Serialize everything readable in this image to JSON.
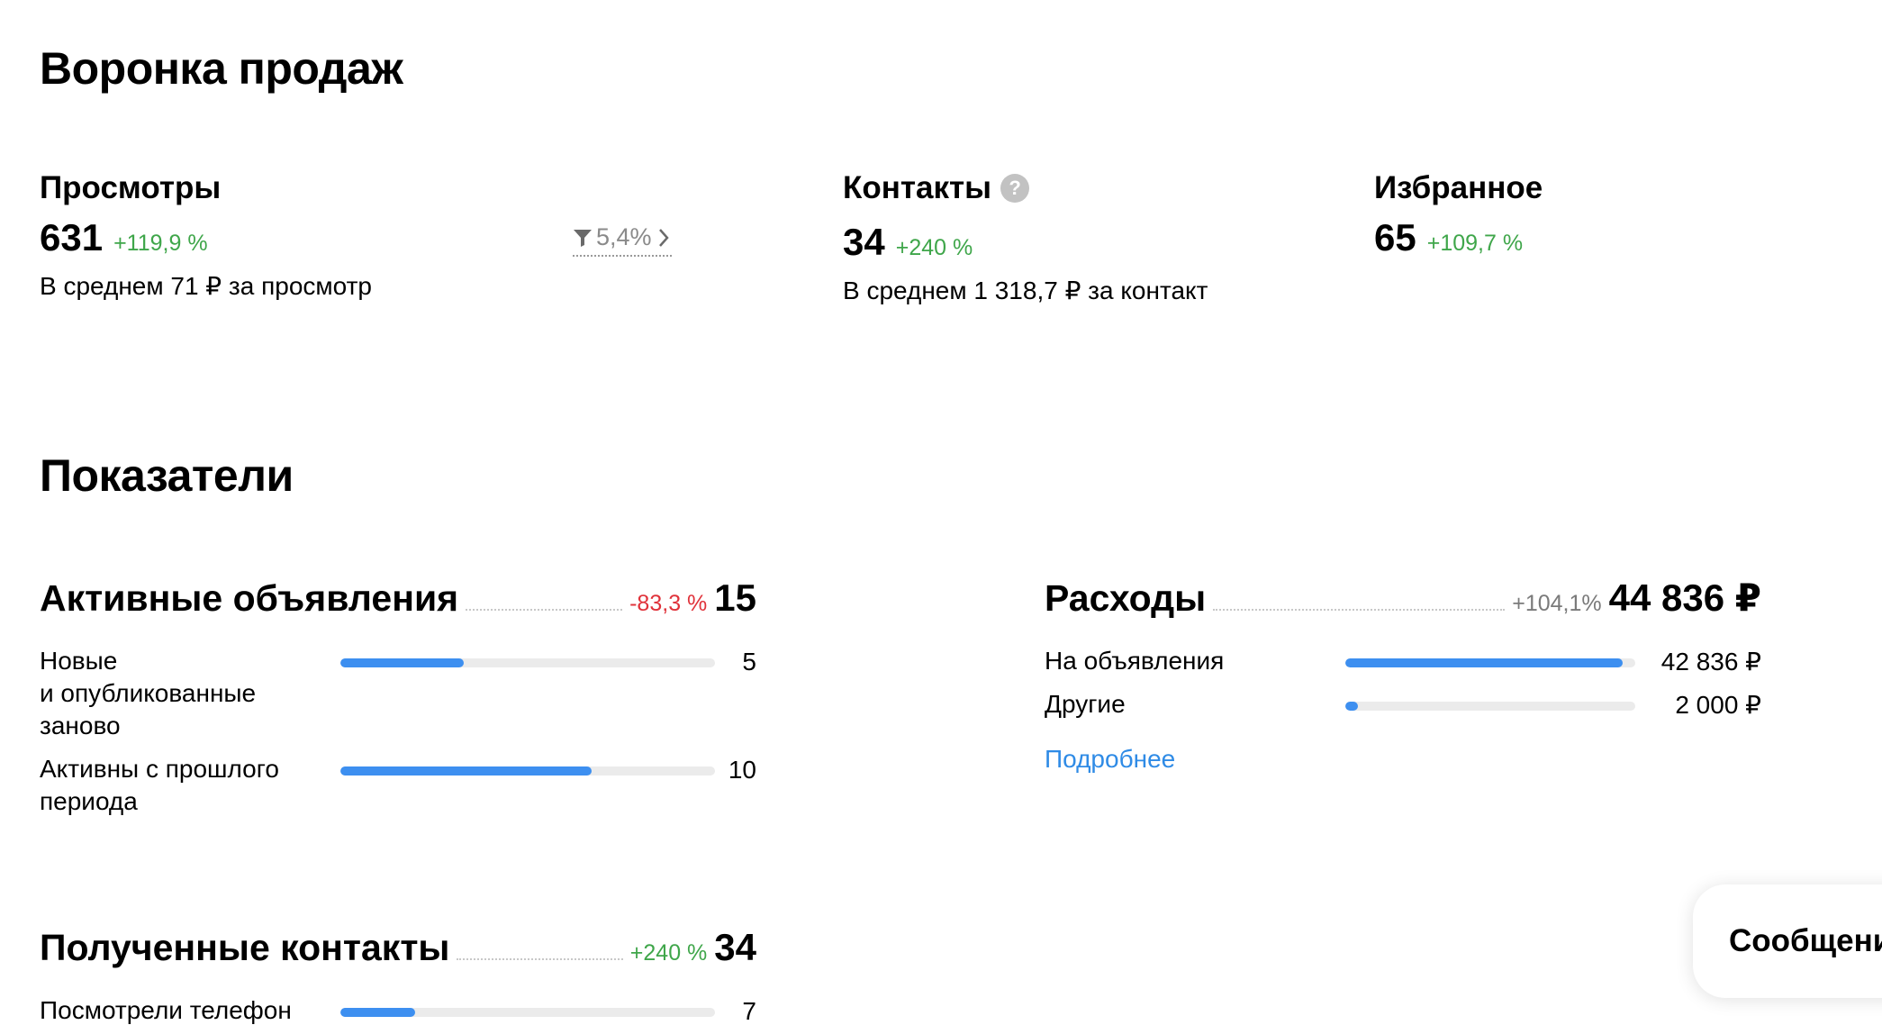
{
  "funnel": {
    "title": "Воронка продаж",
    "views": {
      "title": "Просмотры",
      "value": "631",
      "delta": "+119,9 %",
      "conversion": "5,4%",
      "avg": "В среднем 71 ₽ за просмотр"
    },
    "contacts": {
      "title": "Контакты",
      "help_icon": "?",
      "value": "34",
      "delta": "+240 %",
      "avg": "В среднем 1 318,7 ₽ за контакт"
    },
    "favorites": {
      "title": "Избранное",
      "value": "65",
      "delta": "+109,7 %"
    }
  },
  "indicators": {
    "title": "Показатели",
    "active_ads": {
      "title": "Активные объявления",
      "delta": "-83,3 %",
      "value": "15",
      "rows": [
        {
          "label_lines": [
            "Новые",
            "и опубликованные",
            "заново"
          ],
          "value": "5",
          "fill": 0.33
        },
        {
          "label_lines": [
            "Активны с прошлого",
            "периода"
          ],
          "value": "10",
          "fill": 0.67
        }
      ]
    },
    "expenses": {
      "title": "Расходы",
      "delta": "+104,1%",
      "value": "44 836 ₽",
      "rows": [
        {
          "label": "На объявления",
          "value": "42 836 ₽",
          "fill": 0.955
        },
        {
          "label": "Другие",
          "value": "2 000 ₽",
          "fill": 0.045
        }
      ],
      "more_link": "Подробнее"
    },
    "received_contacts": {
      "title": "Полученные контакты",
      "delta": "+240 %",
      "value": "34",
      "rows": [
        {
          "label": "Посмотрели телефон",
          "value": "7",
          "fill": 0.2
        }
      ]
    }
  },
  "messages_button": "Сообщения",
  "colors": {
    "positive": "#3fa64a",
    "negative": "#e0323a",
    "bar": "#3d8ff0",
    "link": "#2f8be6"
  }
}
